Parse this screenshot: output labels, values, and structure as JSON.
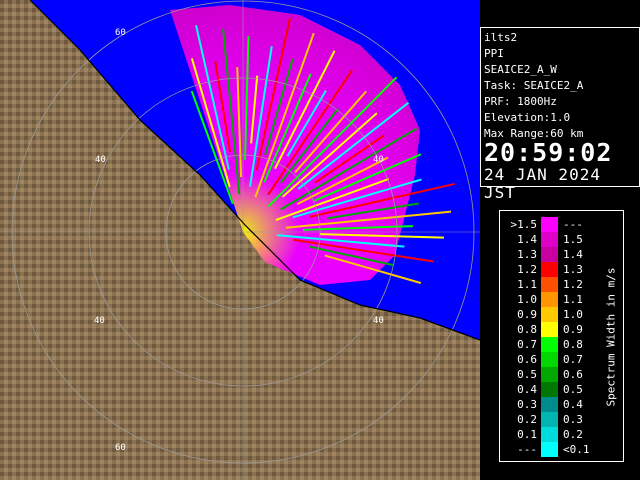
{
  "info": {
    "radar": "ilts2",
    "mode": "PPI",
    "task_name": "SEAICE2_A_W",
    "task": "Task: SEAICE2_A",
    "prf": "PRF: 1800Hz",
    "elevation": "Elevation:1.0",
    "max_range": "Max Range:60 km",
    "time": "20:59:02",
    "date": "24 JAN 2024 JST"
  },
  "legend": {
    "unit": "Spectrum Width in m/s",
    "rows": [
      {
        "left": ">1.5",
        "right": "---",
        "color": "#ff00ff"
      },
      {
        "left": "1.4",
        "right": "1.5",
        "color": "#e000c8"
      },
      {
        "left": "1.3",
        "right": "1.4",
        "color": "#c800a0"
      },
      {
        "left": "1.2",
        "right": "1.3",
        "color": "#ff0000"
      },
      {
        "left": "1.1",
        "right": "1.2",
        "color": "#ff5000"
      },
      {
        "left": "1.0",
        "right": "1.1",
        "color": "#ff9600"
      },
      {
        "left": "0.9",
        "right": "1.0",
        "color": "#ffc800"
      },
      {
        "left": "0.8",
        "right": "0.9",
        "color": "#ffff00"
      },
      {
        "left": "0.7",
        "right": "0.8",
        "color": "#00ff00"
      },
      {
        "left": "0.6",
        "right": "0.7",
        "color": "#00d800"
      },
      {
        "left": "0.5",
        "right": "0.6",
        "color": "#00a800"
      },
      {
        "left": "0.4",
        "right": "0.5",
        "color": "#007800"
      },
      {
        "left": "0.3",
        "right": "0.4",
        "color": "#008c8c"
      },
      {
        "left": "0.2",
        "right": "0.3",
        "color": "#00b4b4"
      },
      {
        "left": "0.1",
        "right": "0.2",
        "color": "#00dcdc"
      },
      {
        "left": "---",
        "right": "<0.1",
        "color": "#00ffff"
      }
    ]
  },
  "map": {
    "range_rings_km": [
      20,
      40,
      60
    ],
    "ring_labels": [
      "60",
      "40",
      "40",
      "40",
      "40",
      "60"
    ],
    "colors": {
      "sea": "#0000ff",
      "land": "#8c7355",
      "rings": "#808080"
    }
  }
}
